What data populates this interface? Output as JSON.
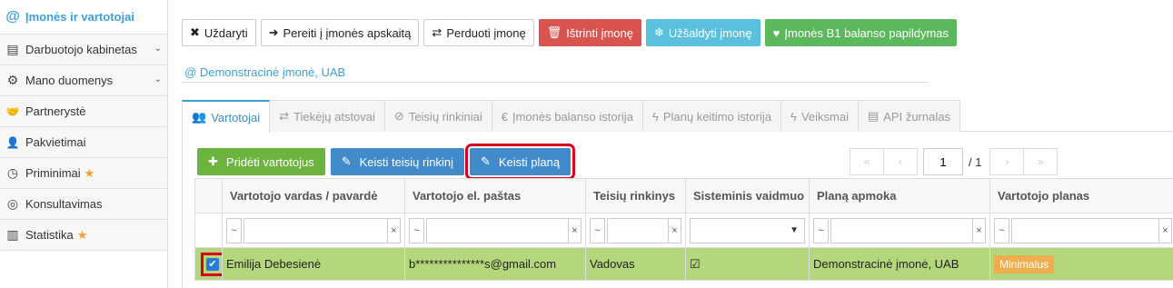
{
  "sidebar": {
    "items": [
      {
        "label": "Įmonės ir vartotojai",
        "icon": "at-icon",
        "glyph": "@"
      },
      {
        "label": "Darbuotojo kabinetas",
        "icon": "id-card-icon",
        "glyph": "▤"
      },
      {
        "label": "Mano duomenys",
        "icon": "gears-icon",
        "glyph": "⚙"
      },
      {
        "label": "Partnerystė",
        "icon": "handshake-icon",
        "glyph": "🤝"
      },
      {
        "label": "Pakvietimai",
        "icon": "user-plus-icon",
        "glyph": "👤"
      },
      {
        "label": "Priminimai",
        "icon": "clock-icon",
        "glyph": "◷"
      },
      {
        "label": "Konsultavimas",
        "icon": "lifebuoy-icon",
        "glyph": "◎"
      },
      {
        "label": "Statistika",
        "icon": "bar-chart-icon",
        "glyph": "▥"
      }
    ]
  },
  "toolbar": {
    "close": "Uždaryti",
    "goto": "Pereiti į įmonės apskaitą",
    "transfer": "Perduoti įmonę",
    "delete": "Ištrinti įmonę",
    "freeze": "Užšaldyti įmonę",
    "topup": "Įmonės B1 balanso papildymas"
  },
  "company_name": "Demonstracinė įmonė, UAB",
  "tabs": [
    "Vartotojai",
    "Tiekėjų atstovai",
    "Teisių rinkiniai",
    "Įmonės balanso istorija",
    "Planų keitimo istorija",
    "Veiksmai",
    "API žurnalas"
  ],
  "actions": {
    "add": "Pridėti vartotojus",
    "edit_rights": "Keisti teisių rinkinį",
    "change_plan": "Keisti planą"
  },
  "pager": {
    "page": "1",
    "total": "/ 1",
    "first": "«",
    "prev": "‹",
    "next": "›",
    "last": "»"
  },
  "table": {
    "headers": [
      "Vartotojo vardas / pavardė",
      "Vartotojo el. paštas",
      "Teisių rinkinys",
      "Sisteminis vaidmuo",
      "Planą apmoka",
      "Vartotojo planas"
    ],
    "filter_op": "~",
    "filter_clear": "×",
    "rows": [
      {
        "name": "Emilija Debesienė",
        "email": "b***************s@gmail.com",
        "rights": "Vadovas",
        "system_role_checked": true,
        "payer": "Demonstracinė įmonė, UAB",
        "plan": "Minimalus"
      }
    ]
  },
  "colors": {
    "accent": "#3aa0d8",
    "red": "#d9534f",
    "freeze": "#5bc0de",
    "topup": "#5cb85c",
    "add": "#6db33f",
    "edit": "#428bca",
    "row_selected": "#b3d77a",
    "plan_badge": "#f0ad4e",
    "highlight": "#d9001b"
  }
}
